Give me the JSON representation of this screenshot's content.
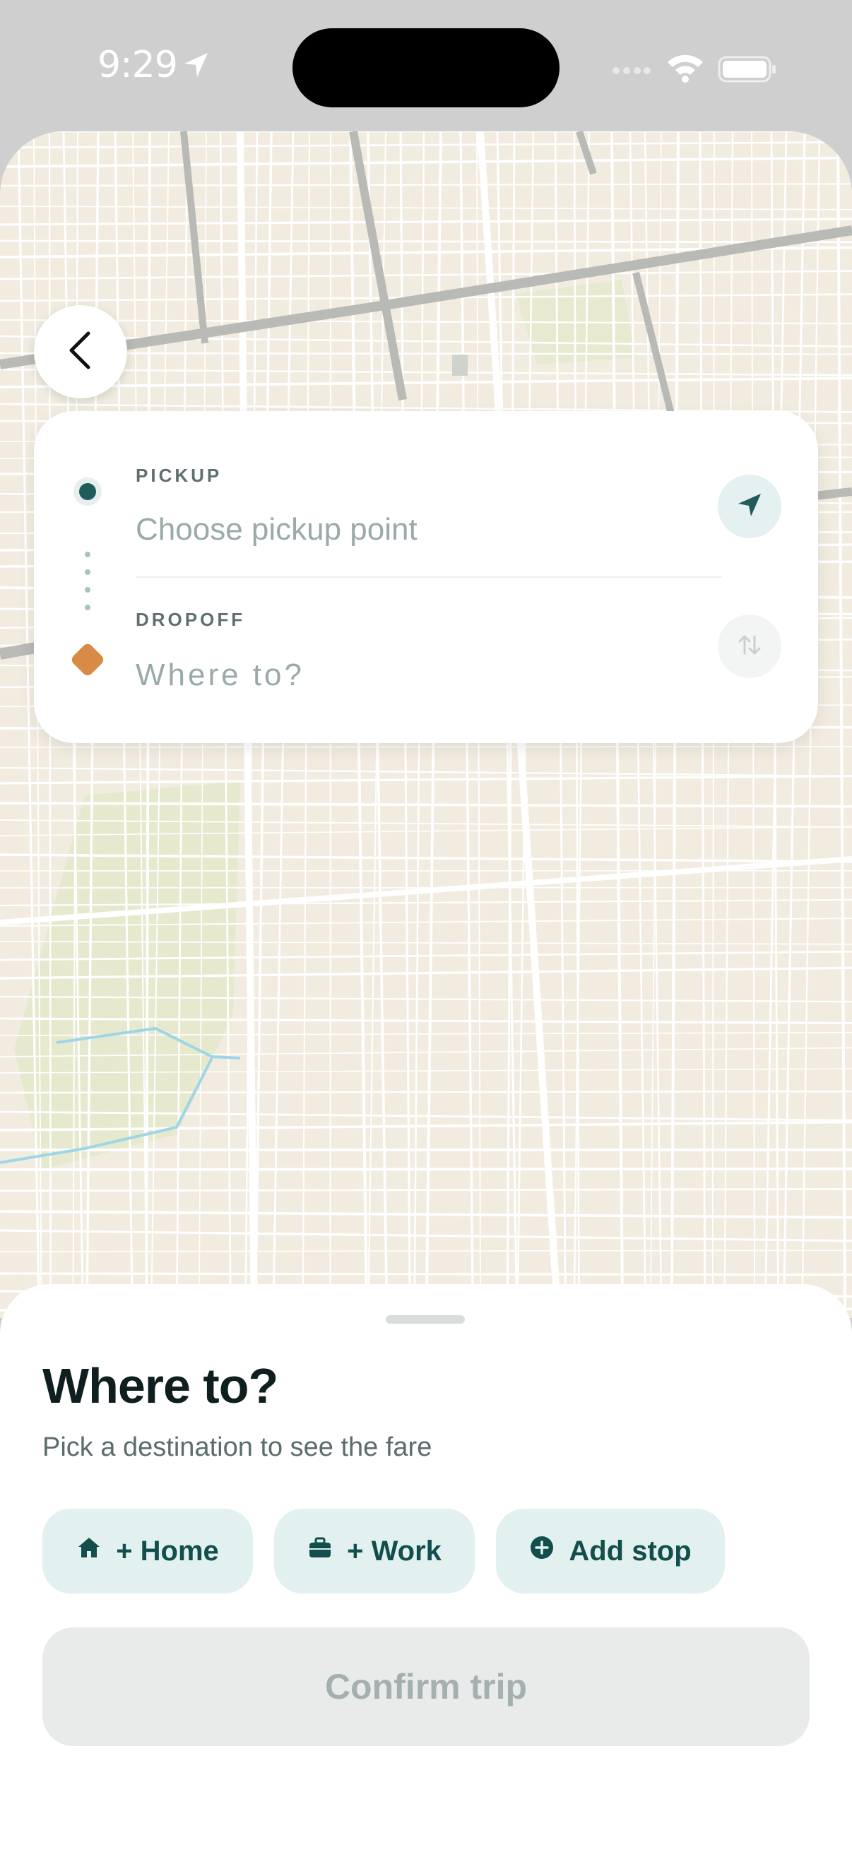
{
  "status_bar": {
    "time": "9:29",
    "icons": [
      "location-arrow-icon",
      "cellular-signal-icon",
      "wifi-icon",
      "battery-icon"
    ]
  },
  "map": {
    "land_color": "#f1ecdf",
    "road_color": "#ffffff",
    "major_road_color": "#b9b9b6",
    "park_color": "#e3e8c9",
    "water_color": "#9ed6e6"
  },
  "route_card": {
    "back_icon": "chevron-left-icon",
    "pickup": {
      "label": "PICKUP",
      "placeholder": "Choose pickup point",
      "action_icon": "navigation-arrow-icon"
    },
    "dropoff": {
      "label": "DROPOFF",
      "placeholder": "Where to?",
      "action_icon": "swap-vertical-icon"
    }
  },
  "sheet": {
    "title": "Where to?",
    "subtitle": "Pick a destination to see the fare",
    "chips": [
      {
        "label": "+ Home",
        "icon": "home-icon"
      },
      {
        "label": "+ Work",
        "icon": "briefcase-icon"
      },
      {
        "label": "Add stop",
        "icon": "plus-circle-icon"
      }
    ],
    "confirm_label": "Confirm trip"
  },
  "colors": {
    "accent": "#1f5c5a",
    "dropoff": "#d98a47",
    "chip_bg": "#e2f0f0"
  }
}
